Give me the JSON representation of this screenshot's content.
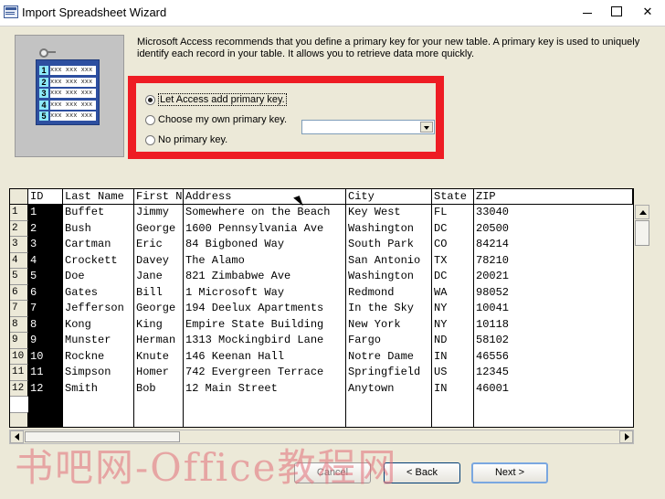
{
  "window": {
    "title": "Import Spreadsheet Wizard"
  },
  "description": "Microsoft Access recommends that you define a primary key for your new table. A primary key is used to uniquely identify each record in your table. It allows you to retrieve data more quickly.",
  "picture": {
    "rows": [
      "1",
      "2",
      "3",
      "4",
      "5"
    ],
    "cells": "xxx xxx xxx"
  },
  "options": {
    "add_pk": "Let Access add primary key.",
    "choose_pk": "Choose my own primary key.",
    "no_pk": "No primary key.",
    "selected": "add_pk",
    "combo_value": ""
  },
  "table": {
    "columns": [
      "ID",
      "Last Name",
      "First N",
      "Address",
      "City",
      "State",
      "ZIP"
    ],
    "rows": [
      [
        "1",
        "Buffet",
        "Jimmy",
        "Somewhere on the Beach",
        "Key West",
        "FL",
        "33040"
      ],
      [
        "2",
        "Bush",
        "George",
        "1600 Pennsylvania Ave",
        "Washington",
        "DC",
        "20500"
      ],
      [
        "3",
        "Cartman",
        "Eric",
        "84 Bigboned Way",
        "South Park",
        "CO",
        "84214"
      ],
      [
        "4",
        "Crockett",
        "Davey",
        "The Alamo",
        "San Antonio",
        "TX",
        "78210"
      ],
      [
        "5",
        "Doe",
        "Jane",
        "821 Zimbabwe Ave",
        "Washington",
        "DC",
        "20021"
      ],
      [
        "6",
        "Gates",
        "Bill",
        "1 Microsoft Way",
        "Redmond",
        "WA",
        "98052"
      ],
      [
        "7",
        "Jefferson",
        "George",
        "194 Deelux Apartments",
        "In the Sky",
        "NY",
        "10041"
      ],
      [
        "8",
        "Kong",
        "King",
        "Empire State Building",
        "New York",
        "NY",
        "10118"
      ],
      [
        "9",
        "Munster",
        "Herman",
        "1313 Mockingbird Lane",
        "Fargo",
        "ND",
        "58102"
      ],
      [
        "10",
        "Rockne",
        "Knute",
        "146 Keenan Hall",
        "Notre Dame",
        "IN",
        "46556"
      ],
      [
        "11",
        "Simpson",
        "Homer",
        "742 Evergreen Terrace",
        "Springfield",
        "US",
        "12345"
      ],
      [
        "12",
        "Smith",
        "Bob",
        "12 Main Street",
        "Anytown",
        "IN",
        "46001"
      ]
    ]
  },
  "buttons": {
    "cancel": "Cancel",
    "back": "< Back",
    "next": "Next >"
  },
  "watermark": "书吧网-Office教程网",
  "colors": {
    "highlight": "#ee1c24",
    "dialog_bg": "#ece9d8"
  }
}
